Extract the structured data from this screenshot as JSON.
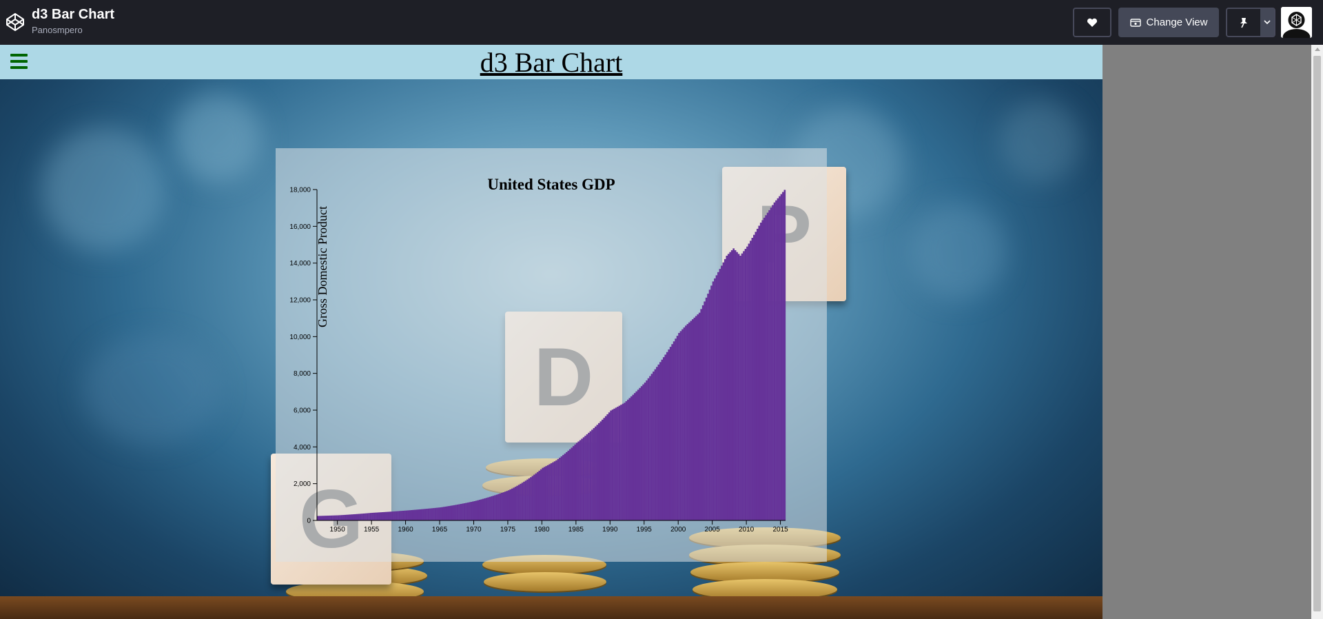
{
  "app": {
    "pen_title": "d3 Bar Chart",
    "author": "Panosmpero",
    "change_view_label": "Change View"
  },
  "page": {
    "title": "d3 Bar Chart"
  },
  "icons": {
    "logo": "codepen-logo-icon",
    "heart": "heart-icon",
    "view": "change-view-icon",
    "pin": "pin-icon",
    "chevron": "chevron-down-icon",
    "menu": "hamburger-menu-icon"
  },
  "colors": {
    "topbar": "#1e1f26",
    "header": "#add8e6",
    "hamburger": "#006400",
    "bar": "#663399"
  },
  "chart_data": {
    "type": "bar",
    "title": "United States GDP",
    "xlabel": "",
    "ylabel": "Gross Domestic Product",
    "xlim": [
      1947,
      2015.75
    ],
    "ylim": [
      0,
      18000
    ],
    "x_ticks": [
      "1950",
      "1955",
      "1960",
      "1965",
      "1970",
      "1975",
      "1980",
      "1985",
      "1990",
      "1995",
      "2000",
      "2005",
      "2010",
      "2015"
    ],
    "y_ticks": [
      "0",
      "2,000",
      "4,000",
      "6,000",
      "8,000",
      "10,000",
      "12,000",
      "14,000",
      "16,000",
      "18,000"
    ],
    "grid": false,
    "legend": "none",
    "bar_color": "#663399",
    "frequency": "quarterly",
    "series": [
      {
        "points": [
          [
            1947,
            243
          ],
          [
            1950,
            280
          ],
          [
            1955,
            415
          ],
          [
            1960,
            540
          ],
          [
            1965,
            710
          ],
          [
            1970,
            1050
          ],
          [
            1975,
            1640
          ],
          [
            1980,
            2860
          ],
          [
            1982,
            3270
          ],
          [
            1985,
            4220
          ],
          [
            1990,
            5980
          ],
          [
            1992,
            6400
          ],
          [
            1995,
            7500
          ],
          [
            2000,
            10200
          ],
          [
            2001,
            10600
          ],
          [
            2003,
            11300
          ],
          [
            2005,
            13000
          ],
          [
            2007,
            14400
          ],
          [
            2008,
            14800
          ],
          [
            2009,
            14400
          ],
          [
            2010,
            14900
          ],
          [
            2012,
            16200
          ],
          [
            2014,
            17300
          ],
          [
            2015.75,
            18100
          ]
        ]
      }
    ]
  }
}
